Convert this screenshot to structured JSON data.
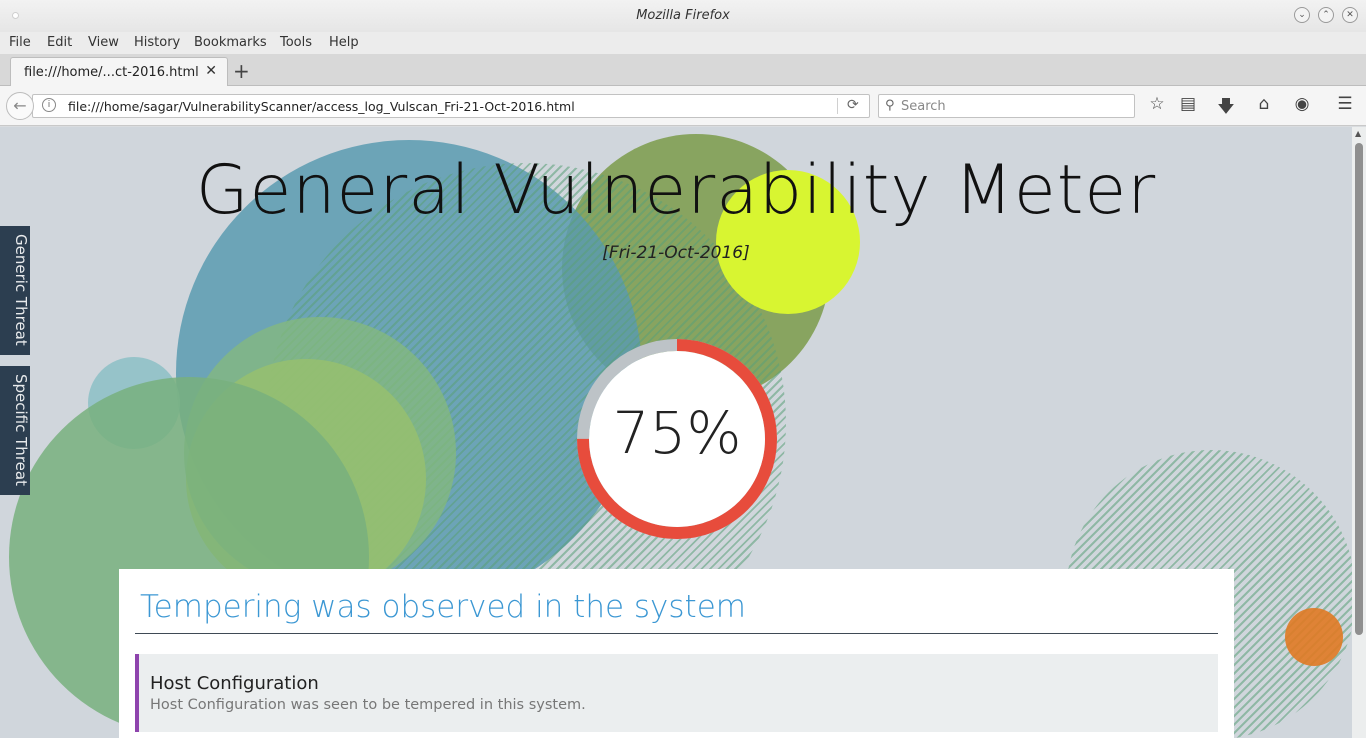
{
  "window": {
    "title": "Mozilla Firefox"
  },
  "menu": [
    "File",
    "Edit",
    "View",
    "History",
    "Bookmarks",
    "Tools",
    "Help"
  ],
  "tab": {
    "label": "file:///home/...ct-2016.html"
  },
  "navbar": {
    "url": "file:///home/sagar/VulnerabilityScanner/access_log_Vulscan_Fri-21-Oct-2016.html",
    "search_placeholder": "Search"
  },
  "page": {
    "title": "General Vulnerability Meter",
    "date": "[Fri-21-Oct-2016]",
    "meter": {
      "value": 75,
      "label": "75%",
      "color": "#e74c3c",
      "track_color": "#bdc3c7"
    },
    "side_tabs": [
      "Generic Threat",
      "Specific Threat"
    ],
    "section_title": "Tempering was observed in the system",
    "findings": [
      {
        "title": "Host Configuration",
        "description": "Host Configuration was seen to be tempered in this system."
      }
    ]
  },
  "colors": {
    "accent": "#3b97d3",
    "finding_border": "#8e44ad",
    "side_tab_bg": "#2c3e50"
  }
}
